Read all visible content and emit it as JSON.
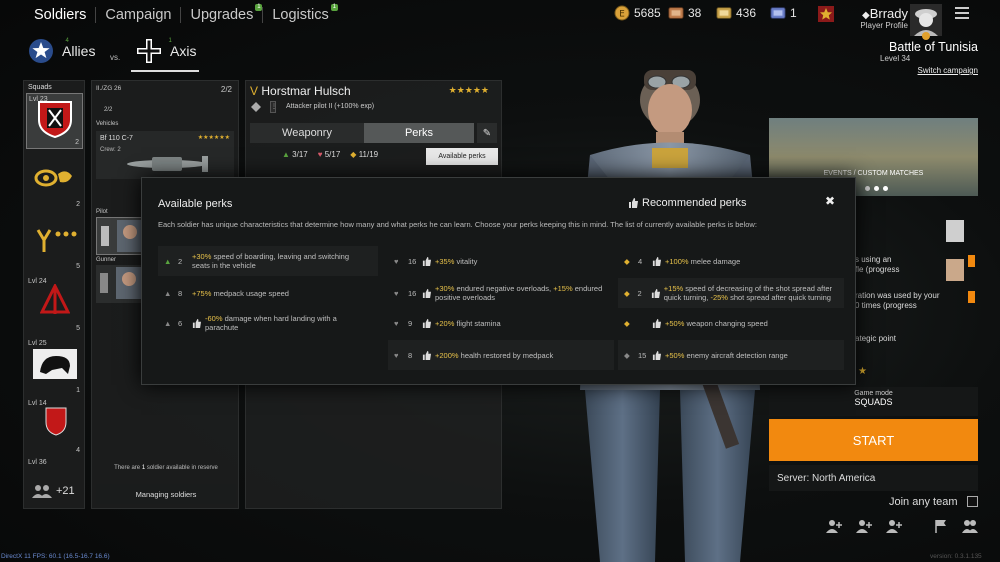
{
  "nav": {
    "items": [
      {
        "label": "Soldiers"
      },
      {
        "label": "Campaign"
      },
      {
        "label": "Upgrades",
        "badge": "1"
      },
      {
        "label": "Logistics",
        "badge": "1"
      }
    ]
  },
  "currency": {
    "gold": "5685",
    "silver_tickets": "38",
    "gold_tickets": "436",
    "blue_tickets": "1"
  },
  "profile": {
    "name": "Brrady",
    "subtitle": "Player Profile"
  },
  "campaign": {
    "title": "Battle of Tunisia",
    "level": "Level 34",
    "switch": "Switch campaign"
  },
  "faction": {
    "allies": "Allies",
    "allies_count": "4",
    "vs": "vs.",
    "axis": "Axis",
    "axis_count": "1"
  },
  "squads": {
    "header": "Squads",
    "items": [
      {
        "level": "Lvl 23",
        "count": "2"
      },
      {
        "level": "",
        "count": "2"
      },
      {
        "level": "",
        "count": "5"
      },
      {
        "level": "Lvl 24",
        "count": "5"
      },
      {
        "level": "Lvl 25",
        "count": "1"
      },
      {
        "level": "Lvl 14",
        "count": "4"
      },
      {
        "level": "Lvl 36",
        "count": ""
      }
    ],
    "reserve": "+21"
  },
  "squad_detail": {
    "name": "II./ZG 26",
    "slots": "2/2",
    "crew_count": "2/2",
    "vehicles_label": "Vehicles",
    "vehicle_name": "Bf 110 C-7",
    "vehicle_stars": "★★★★★★",
    "crew": "Crew: 2",
    "pilot_label": "Pilot",
    "gunner_label": "Gunner",
    "reserve_note_pre": "There are ",
    "reserve_note_num": "1",
    "reserve_note_post": " soldier available in reserve",
    "manage": "Managing soldiers"
  },
  "soldier": {
    "rank": "V",
    "name": "Horstmar Hulsch",
    "stars": "★★★★★",
    "class": "Attacker pilot II",
    "exp": "(+100% exp)",
    "tab_weaponry": "Weaponry",
    "tab_perks": "Perks",
    "stat_green": "3/17",
    "stat_red": "5/17",
    "stat_yellow": "11/19",
    "available_perks_btn": "Available perks"
  },
  "modal": {
    "title": "Available perks",
    "recommended": "Recommended perks",
    "description": "Each soldier has unique characteristics that determine how many and what perks he can learn. Choose your perks keeping this in mind. The list of currently available perks is below:",
    "col1": [
      {
        "num": "2",
        "hl": "+30%",
        "text": " speed of boarding, leaving and switching seats in the vehicle",
        "thumb": false
      },
      {
        "num": "8",
        "hl": "+75%",
        "text": " medpack usage speed",
        "thumb": false
      },
      {
        "num": "6",
        "hl": "-60%",
        "text": " damage when hard landing with a parachute",
        "thumb": true
      }
    ],
    "col2": [
      {
        "num": "16",
        "hl": "+35%",
        "text": " vitality",
        "thumb": true
      },
      {
        "num": "16",
        "hl": "+30%",
        "text": " endured negative overloads, ",
        "hl2": "+15%",
        "text2": " endured positive overloads",
        "thumb": true
      },
      {
        "num": "9",
        "hl": "+20%",
        "text": " flight stamina",
        "thumb": true
      },
      {
        "num": "8",
        "hl": "+200%",
        "text": " health restored by medpack",
        "thumb": true
      }
    ],
    "col3": [
      {
        "num": "4",
        "hl": "+100%",
        "text": " melee damage",
        "thumb": true
      },
      {
        "num": "2",
        "hl": "+15%",
        "text": " speed of decreasing of the shot spread after quick turning, ",
        "hl2": "-25%",
        "text2": " shot spread after quick turning",
        "thumb": true
      },
      {
        "num": "",
        "hl": "+50%",
        "text": " weapon changing speed",
        "thumb": true
      },
      {
        "num": "15",
        "hl": "+50%",
        "text": " enemy aircraft detection range",
        "thumb": true
      }
    ]
  },
  "right": {
    "events": "EVENTS / CUSTOM MATCHES",
    "task1": "s using an",
    "task1b": "fle (progress",
    "task2": "ration was used by your",
    "task2b": "0 times (progress",
    "task3": "ategic point",
    "gamemode_label": "Game mode",
    "gamemode_value": "SQUADS",
    "start": "START",
    "server": "Server: North America",
    "join_any": "Join any team"
  },
  "footer": {
    "fps": "DirectX 11 FPS: 60.1 (16.5-16.7 16.6)",
    "version": "version: 0.3.1.135"
  },
  "colors": {
    "accent_orange": "#f2890f",
    "perk_highlight": "#e8c24a",
    "badge_green": "#59a33e"
  }
}
